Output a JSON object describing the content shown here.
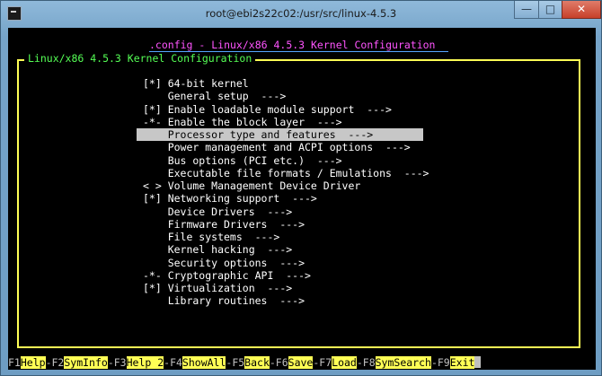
{
  "window": {
    "title": "root@ebi2s22c02:/usr/src/linux-4.5.3",
    "minimize_glyph": "—",
    "maximize_glyph": "□",
    "close_glyph": "✕"
  },
  "config_title": ".config - Linux/x86 4.5.3 Kernel Configuration",
  "dialog_title": "Linux/x86 4.5.3 Kernel Configuration",
  "menu": [
    {
      "text": "[*] 64-bit kernel",
      "selected": false
    },
    {
      "text": "    General setup  --->",
      "selected": false
    },
    {
      "text": "[*] Enable loadable module support  --->",
      "selected": false
    },
    {
      "text": "-*- Enable the block layer  --->",
      "selected": false
    },
    {
      "text": "    Processor type and features  --->",
      "selected": true
    },
    {
      "text": "    Power management and ACPI options  --->",
      "selected": false
    },
    {
      "text": "    Bus options (PCI etc.)  --->",
      "selected": false
    },
    {
      "text": "    Executable file formats / Emulations  --->",
      "selected": false
    },
    {
      "text": "< > Volume Management Device Driver",
      "selected": false
    },
    {
      "text": "[*] Networking support  --->",
      "selected": false
    },
    {
      "text": "    Device Drivers  --->",
      "selected": false
    },
    {
      "text": "    Firmware Drivers  --->",
      "selected": false
    },
    {
      "text": "    File systems  --->",
      "selected": false
    },
    {
      "text": "    Kernel hacking  --->",
      "selected": false
    },
    {
      "text": "    Security options  --->",
      "selected": false
    },
    {
      "text": "-*- Cryptographic API  --->",
      "selected": false
    },
    {
      "text": "[*] Virtualization  --->",
      "selected": false
    },
    {
      "text": "    Library routines  --->",
      "selected": false
    }
  ],
  "fkeys": [
    {
      "key": "F1",
      "label": "Help"
    },
    {
      "key": "-F2",
      "label": "SymInfo"
    },
    {
      "key": "-F3",
      "label": "Help 2"
    },
    {
      "key": "-F4",
      "label": "ShowAll"
    },
    {
      "key": "-F5",
      "label": "Back"
    },
    {
      "key": "-F6",
      "label": "Save"
    },
    {
      "key": "-F7",
      "label": "Load"
    },
    {
      "key": "-F8",
      "label": "SymSearch"
    },
    {
      "key": "-F9",
      "label": "Exit"
    }
  ],
  "colors": {
    "selection_bg": "#c7c7c7",
    "config_title": "#ff55ff",
    "dialog_border": "#ffff55",
    "dialog_title": "#55ff55",
    "fkey_highlight": "#ffff55"
  }
}
